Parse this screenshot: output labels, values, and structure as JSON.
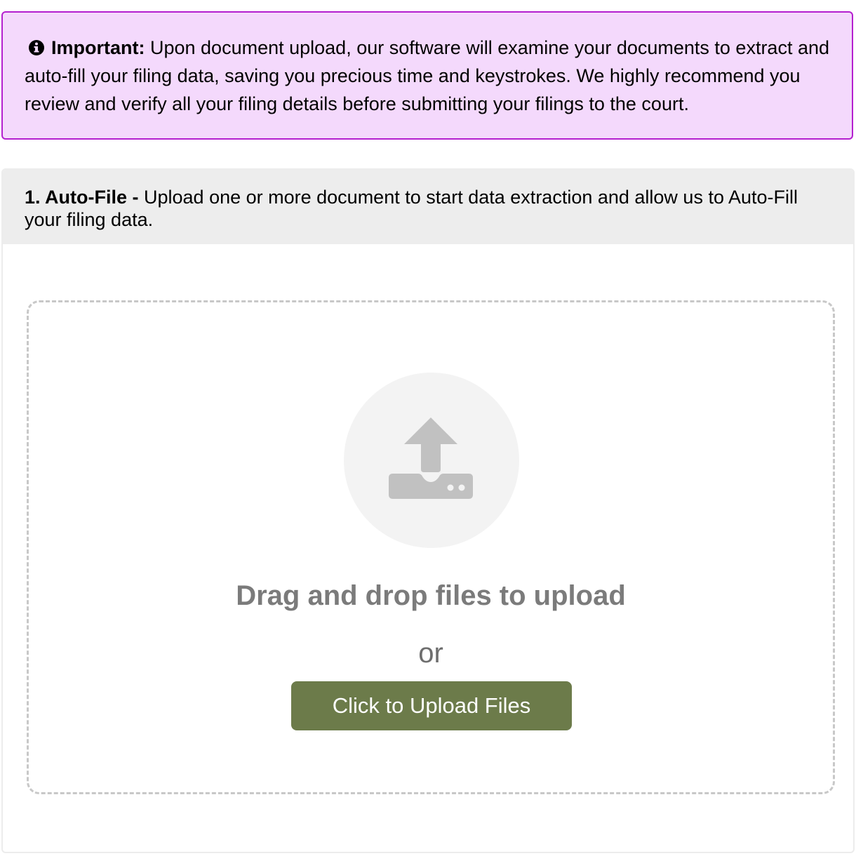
{
  "notice": {
    "icon": "info-circle-icon",
    "label": "Important:",
    "text": " Upon document upload, our software will examine your documents to extract and auto-fill your filing data, saving you precious time and keystrokes. We highly recommend you review and verify all your filing details before submitting your filings to the court.",
    "background_color": "#f4d9fc",
    "border_color": "#b420cf"
  },
  "auto_file": {
    "step_title": "1. Auto-File -",
    "description": " Upload one or more document to start data extraction and allow us to Auto-Fill your filing data."
  },
  "dropzone": {
    "icon": "upload-icon",
    "drop_text": "Drag and drop files to upload",
    "or_text": "or",
    "button_label": "Click to Upload Files",
    "button_color": "#6c7b4a"
  }
}
